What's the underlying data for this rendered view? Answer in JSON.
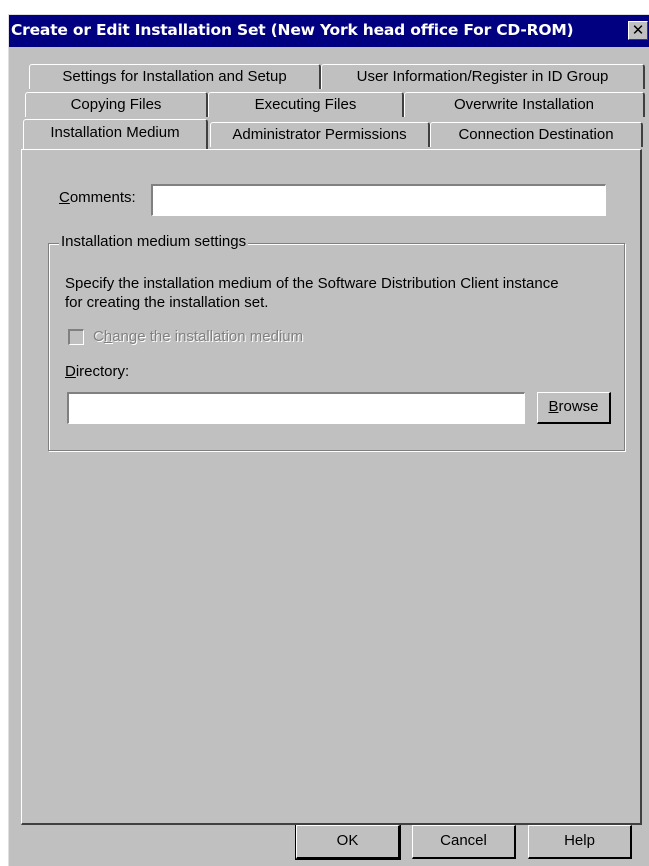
{
  "window": {
    "title": "Create or Edit Installation Set (New York head office For CD-ROM)",
    "close_glyph": "✕"
  },
  "tabs": {
    "row1": [
      "Settings for Installation and Setup",
      "User Information/Register in ID Group"
    ],
    "row2": [
      "Copying Files",
      "Executing Files",
      "Overwrite Installation"
    ],
    "row3": [
      "Installation Medium",
      "Administrator Permissions",
      "Connection Destination"
    ],
    "active": "Installation Medium"
  },
  "form": {
    "comments_label_accel": "C",
    "comments_label_rest": "omments:",
    "comments_value": "",
    "group_caption": "Installation medium settings",
    "description_line1": "Specify the installation medium of the Software Distribution Client instance",
    "description_line2": "for creating the installation set.",
    "change_medium_pre": "C",
    "change_medium_accel": "h",
    "change_medium_post": "ange the installation medium",
    "change_medium_checked": false,
    "directory_label_accel": "D",
    "directory_label_rest": "irectory:",
    "directory_value": "",
    "browse_accel": "B",
    "browse_rest": "rowse"
  },
  "buttons": {
    "ok": "OK",
    "cancel": "Cancel",
    "help": "Help"
  },
  "colors": {
    "titlebar": "#000080",
    "face": "#c0c0c0",
    "disabled_text": "#808080"
  }
}
